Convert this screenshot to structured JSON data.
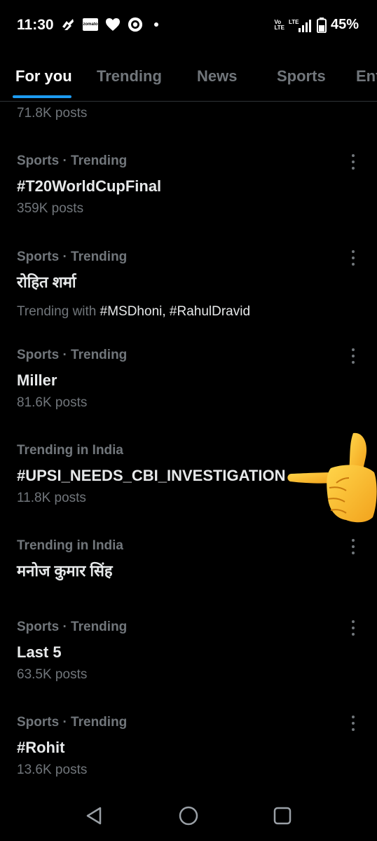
{
  "status_bar": {
    "time": "11:30",
    "zomato_label": "zomato",
    "network_top": "Vo",
    "network_bottom": "LTE",
    "lte_label": "LTE",
    "battery": "45%"
  },
  "tabs": [
    {
      "label": "For you",
      "active": true
    },
    {
      "label": "Trending",
      "active": false
    },
    {
      "label": "News",
      "active": false
    },
    {
      "label": "Sports",
      "active": false
    },
    {
      "label": "Ent",
      "active": false
    }
  ],
  "partial_trend": {
    "count": "71.8K posts"
  },
  "trends": [
    {
      "meta": "Sports · Trending",
      "name": "#T20WorldCupFinal",
      "count": "359K posts"
    },
    {
      "meta": "Sports · Trending",
      "name": "रोहित शर्मा",
      "with_label": "Trending with",
      "with_tags": "#MSDhoni, #RahulDravid"
    },
    {
      "meta": "Sports · Trending",
      "name": "Miller",
      "count": "81.6K posts"
    },
    {
      "meta": "Trending in India",
      "name": "#UPSI_NEEDS_CBI_INVESTIGATION",
      "count": "11.8K posts"
    },
    {
      "meta": "Trending in India",
      "name": "मनोज कुमार सिंह"
    },
    {
      "meta": "Sports · Trending",
      "name": "Last 5",
      "count": "63.5K posts"
    },
    {
      "meta": "Sports · Trending",
      "name": "#Rohit",
      "count": "13.6K posts"
    }
  ],
  "icons": {
    "more": "more-vertical-icon",
    "back": "back-triangle-icon",
    "home": "home-circle-icon",
    "recents": "recents-square-icon",
    "hand": "backhand-index-pointing-left-emoji"
  },
  "colors": {
    "background": "#000000",
    "primary_text": "#e7e9ea",
    "secondary_text": "#71767b",
    "accent": "#1d9bf0",
    "divider": "#2f3336"
  }
}
